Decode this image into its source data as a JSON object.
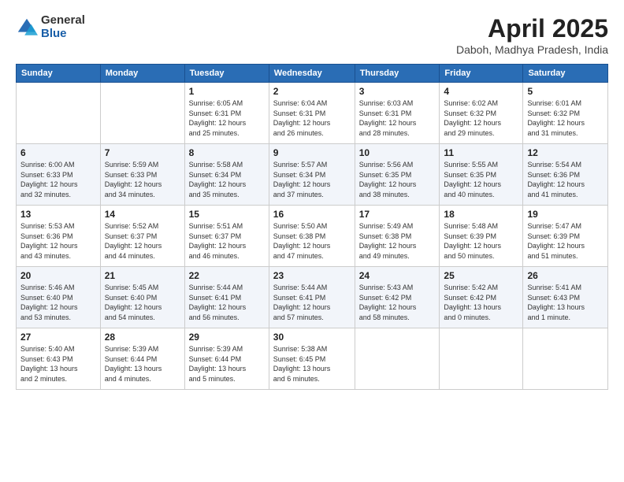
{
  "logo": {
    "general": "General",
    "blue": "Blue"
  },
  "title": {
    "month": "April 2025",
    "location": "Daboh, Madhya Pradesh, India"
  },
  "headers": [
    "Sunday",
    "Monday",
    "Tuesday",
    "Wednesday",
    "Thursday",
    "Friday",
    "Saturday"
  ],
  "weeks": [
    [
      {
        "day": "",
        "info": ""
      },
      {
        "day": "",
        "info": ""
      },
      {
        "day": "1",
        "info": "Sunrise: 6:05 AM\nSunset: 6:31 PM\nDaylight: 12 hours\nand 25 minutes."
      },
      {
        "day": "2",
        "info": "Sunrise: 6:04 AM\nSunset: 6:31 PM\nDaylight: 12 hours\nand 26 minutes."
      },
      {
        "day": "3",
        "info": "Sunrise: 6:03 AM\nSunset: 6:31 PM\nDaylight: 12 hours\nand 28 minutes."
      },
      {
        "day": "4",
        "info": "Sunrise: 6:02 AM\nSunset: 6:32 PM\nDaylight: 12 hours\nand 29 minutes."
      },
      {
        "day": "5",
        "info": "Sunrise: 6:01 AM\nSunset: 6:32 PM\nDaylight: 12 hours\nand 31 minutes."
      }
    ],
    [
      {
        "day": "6",
        "info": "Sunrise: 6:00 AM\nSunset: 6:33 PM\nDaylight: 12 hours\nand 32 minutes."
      },
      {
        "day": "7",
        "info": "Sunrise: 5:59 AM\nSunset: 6:33 PM\nDaylight: 12 hours\nand 34 minutes."
      },
      {
        "day": "8",
        "info": "Sunrise: 5:58 AM\nSunset: 6:34 PM\nDaylight: 12 hours\nand 35 minutes."
      },
      {
        "day": "9",
        "info": "Sunrise: 5:57 AM\nSunset: 6:34 PM\nDaylight: 12 hours\nand 37 minutes."
      },
      {
        "day": "10",
        "info": "Sunrise: 5:56 AM\nSunset: 6:35 PM\nDaylight: 12 hours\nand 38 minutes."
      },
      {
        "day": "11",
        "info": "Sunrise: 5:55 AM\nSunset: 6:35 PM\nDaylight: 12 hours\nand 40 minutes."
      },
      {
        "day": "12",
        "info": "Sunrise: 5:54 AM\nSunset: 6:36 PM\nDaylight: 12 hours\nand 41 minutes."
      }
    ],
    [
      {
        "day": "13",
        "info": "Sunrise: 5:53 AM\nSunset: 6:36 PM\nDaylight: 12 hours\nand 43 minutes."
      },
      {
        "day": "14",
        "info": "Sunrise: 5:52 AM\nSunset: 6:37 PM\nDaylight: 12 hours\nand 44 minutes."
      },
      {
        "day": "15",
        "info": "Sunrise: 5:51 AM\nSunset: 6:37 PM\nDaylight: 12 hours\nand 46 minutes."
      },
      {
        "day": "16",
        "info": "Sunrise: 5:50 AM\nSunset: 6:38 PM\nDaylight: 12 hours\nand 47 minutes."
      },
      {
        "day": "17",
        "info": "Sunrise: 5:49 AM\nSunset: 6:38 PM\nDaylight: 12 hours\nand 49 minutes."
      },
      {
        "day": "18",
        "info": "Sunrise: 5:48 AM\nSunset: 6:39 PM\nDaylight: 12 hours\nand 50 minutes."
      },
      {
        "day": "19",
        "info": "Sunrise: 5:47 AM\nSunset: 6:39 PM\nDaylight: 12 hours\nand 51 minutes."
      }
    ],
    [
      {
        "day": "20",
        "info": "Sunrise: 5:46 AM\nSunset: 6:40 PM\nDaylight: 12 hours\nand 53 minutes."
      },
      {
        "day": "21",
        "info": "Sunrise: 5:45 AM\nSunset: 6:40 PM\nDaylight: 12 hours\nand 54 minutes."
      },
      {
        "day": "22",
        "info": "Sunrise: 5:44 AM\nSunset: 6:41 PM\nDaylight: 12 hours\nand 56 minutes."
      },
      {
        "day": "23",
        "info": "Sunrise: 5:44 AM\nSunset: 6:41 PM\nDaylight: 12 hours\nand 57 minutes."
      },
      {
        "day": "24",
        "info": "Sunrise: 5:43 AM\nSunset: 6:42 PM\nDaylight: 12 hours\nand 58 minutes."
      },
      {
        "day": "25",
        "info": "Sunrise: 5:42 AM\nSunset: 6:42 PM\nDaylight: 13 hours\nand 0 minutes."
      },
      {
        "day": "26",
        "info": "Sunrise: 5:41 AM\nSunset: 6:43 PM\nDaylight: 13 hours\nand 1 minute."
      }
    ],
    [
      {
        "day": "27",
        "info": "Sunrise: 5:40 AM\nSunset: 6:43 PM\nDaylight: 13 hours\nand 2 minutes."
      },
      {
        "day": "28",
        "info": "Sunrise: 5:39 AM\nSunset: 6:44 PM\nDaylight: 13 hours\nand 4 minutes."
      },
      {
        "day": "29",
        "info": "Sunrise: 5:39 AM\nSunset: 6:44 PM\nDaylight: 13 hours\nand 5 minutes."
      },
      {
        "day": "30",
        "info": "Sunrise: 5:38 AM\nSunset: 6:45 PM\nDaylight: 13 hours\nand 6 minutes."
      },
      {
        "day": "",
        "info": ""
      },
      {
        "day": "",
        "info": ""
      },
      {
        "day": "",
        "info": ""
      }
    ]
  ]
}
